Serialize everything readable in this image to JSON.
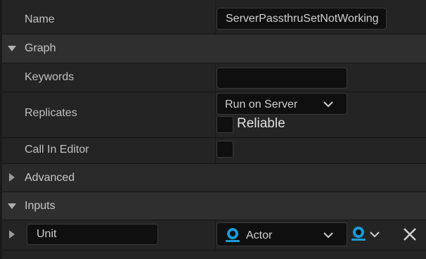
{
  "details": {
    "name_label": "Name",
    "name_value": "ServerPassthruSetNotWorking",
    "graph_section": "Graph",
    "keywords_label": "Keywords",
    "keywords_value": "",
    "replicates_label": "Replicates",
    "replicates_value": "Run on Server",
    "reliable_label": "Reliable",
    "reliable_checked": false,
    "call_in_editor_label": "Call In Editor",
    "call_in_editor_checked": false,
    "advanced_section": "Advanced",
    "inputs_section": "Inputs",
    "inputs": [
      {
        "name": "Unit",
        "type": "Actor"
      }
    ]
  },
  "colors": {
    "background": "#242424",
    "section_header": "#2f2f2f",
    "field_bg": "#0f0f0f",
    "actor_pin": "#1e9ad6"
  },
  "icons": [
    "chevron-down-icon",
    "expand-arrow-icon",
    "collapse-arrow-icon",
    "actor-pin-icon",
    "remove-x-icon"
  ]
}
